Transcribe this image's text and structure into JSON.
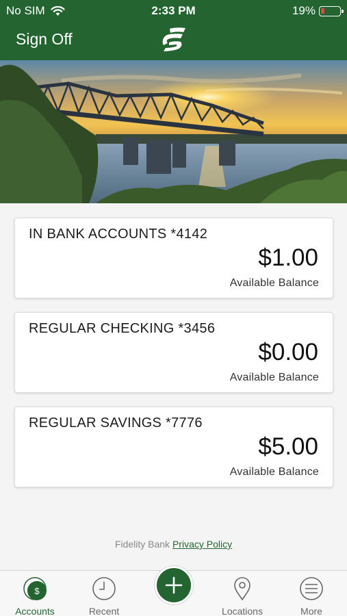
{
  "status_bar": {
    "carrier": "No SIM",
    "time": "2:33 PM",
    "battery_percent_label": "19%",
    "battery_level": 0.19
  },
  "nav": {
    "sign_off_label": "Sign Off",
    "logo_icon": "fidelity-bank-logo-icon"
  },
  "accounts": [
    {
      "name": "IN BANK ACCOUNTS *4142",
      "amount": "$1.00",
      "balance_label": "Available Balance"
    },
    {
      "name": "REGULAR CHECKING *3456",
      "amount": "$0.00",
      "balance_label": "Available Balance"
    },
    {
      "name": "REGULAR SAVINGS *7776",
      "amount": "$5.00",
      "balance_label": "Available Balance"
    }
  ],
  "footer": {
    "bank_name": "Fidelity Bank",
    "privacy_link": "Privacy Policy"
  },
  "tabs": [
    {
      "label": "Accounts",
      "icon": "accounts-dollar-icon",
      "active": true
    },
    {
      "label": "Recent",
      "icon": "clock-icon",
      "active": false
    },
    {
      "label": "Locations",
      "icon": "location-pin-icon",
      "active": false
    },
    {
      "label": "More",
      "icon": "menu-icon",
      "active": false
    }
  ],
  "fab_icon": "plus-icon",
  "colors": {
    "brand_green": "#236431",
    "battery_low": "#e2473b"
  }
}
